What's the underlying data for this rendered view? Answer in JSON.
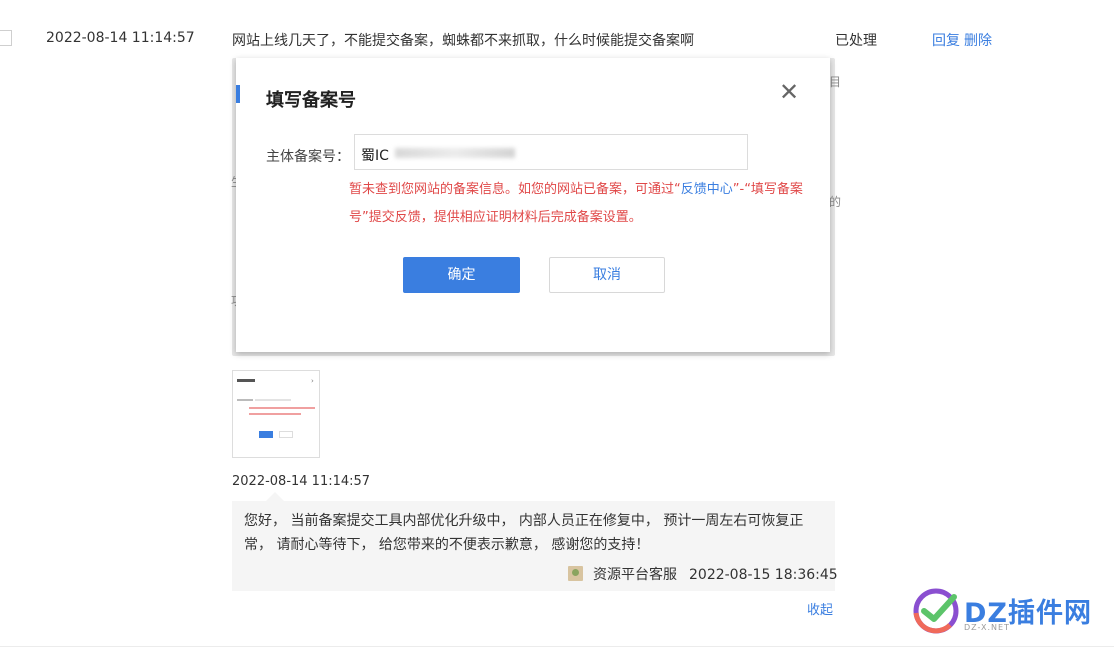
{
  "record": {
    "date": "2022-08-14 11:14:57",
    "title": "网站上线几天了，不能提交备案，蜘蛛都不来抓取，什么时候能提交备案啊",
    "status": "已处理",
    "actions": {
      "reply": "回复",
      "delete": "删除"
    }
  },
  "screenshot_dialog": {
    "title": "填写备案号",
    "close_icon": "close-icon",
    "field_label": "主体备案号：",
    "field_value": "蜀IC",
    "error_part1": "暂未查到您网站的备案信息。如您的网站已备案，可通过“",
    "error_link": "反馈中心",
    "error_part2": "”-“填写备案号”提交反馈，提供相应证明材料后完成备案设置。",
    "confirm_label": "确定",
    "cancel_label": "取消",
    "edge_chars": [
      "目",
      "生",
      "功",
      "的"
    ]
  },
  "reply": {
    "date": "2022-08-14 11:14:57",
    "text": "您好， 当前备案提交工具内部优化升级中， 内部人员正在修复中， 预计一周左右可恢复正常， 请耐心等待下， 给您带来的不便表示歉意， 感谢您的支持！",
    "author": "资源平台客服",
    "time": "2022-08-15 18:36:45",
    "collapse_label": "收起"
  },
  "watermark": {
    "text": "DZ插件网",
    "sub": "DZ-X.NET"
  },
  "colors": {
    "accent": "#3a7ee0",
    "error": "#e04848",
    "reply_bg": "#f5f5f5"
  }
}
